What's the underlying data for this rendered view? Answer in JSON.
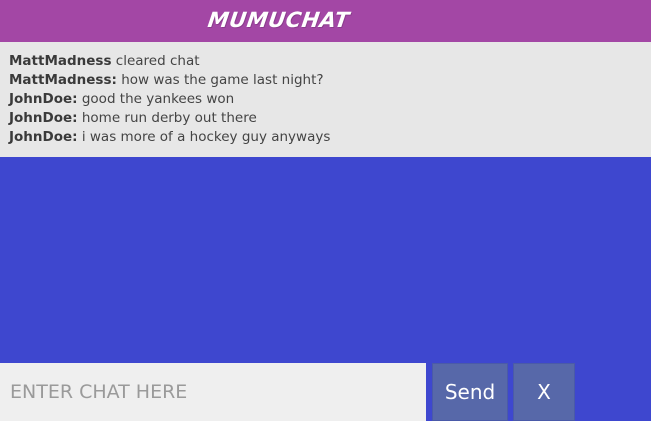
{
  "header": {
    "logo_text": "MUMUCHAT"
  },
  "chat": {
    "messages": [
      {
        "user": "MattMadness",
        "separator": "",
        "text": " cleared chat"
      },
      {
        "user": "MattMadness",
        "separator": ":",
        "text": " how was the game last night?"
      },
      {
        "user": "JohnDoe",
        "separator": ":",
        "text": " good the yankees won"
      },
      {
        "user": "JohnDoe",
        "separator": ":",
        "text": " home run derby out there"
      },
      {
        "user": "JohnDoe",
        "separator": ":",
        "text": " i was more of a hockey guy anyways"
      }
    ]
  },
  "input": {
    "placeholder": "ENTER CHAT HERE",
    "value": ""
  },
  "buttons": {
    "send_label": "Send",
    "close_label": "X"
  },
  "colors": {
    "header_bg": "#a347a5",
    "chat_bg": "#e7e7e7",
    "page_bg": "#3e47cf",
    "button_bg": "#5768a9"
  }
}
